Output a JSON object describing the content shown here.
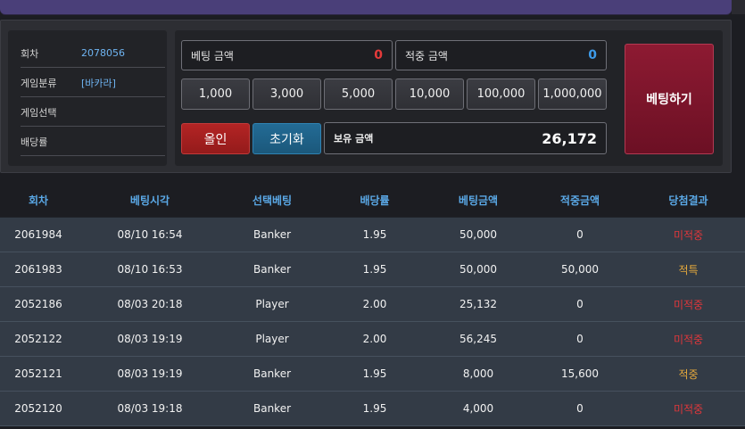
{
  "info": {
    "round_label": "회차",
    "round_value": "2078056",
    "category_label": "게임분류",
    "category_value": "[바카라]",
    "selection_label": "게임선택",
    "selection_value": "",
    "odds_label": "배당률",
    "odds_value": ""
  },
  "bet": {
    "amount_label": "베팅 금액",
    "amount_value": "0",
    "amount_color": "#e53a3a",
    "win_label": "적중 금액",
    "win_value": "0",
    "win_color": "#3d9be9",
    "chips": [
      "1,000",
      "3,000",
      "5,000",
      "10,000",
      "100,000",
      "1,000,000"
    ],
    "allin_label": "올인",
    "reset_label": "초기화",
    "balance_label": "보유 금액",
    "balance_value": "26,172",
    "submit_label": "베팅하기"
  },
  "history": {
    "headers": [
      "회차",
      "베팅시각",
      "선택베팅",
      "배당률",
      "베팅금액",
      "적중금액",
      "당첨결과"
    ],
    "rows": [
      {
        "round": "2061984",
        "time": "08/10 16:54",
        "pick": "Banker",
        "odds": "1.95",
        "bet": "50,000",
        "win": "0",
        "result": "미적중",
        "status": "lose"
      },
      {
        "round": "2061983",
        "time": "08/10 16:53",
        "pick": "Banker",
        "odds": "1.95",
        "bet": "50,000",
        "win": "50,000",
        "result": "적특",
        "status": "win"
      },
      {
        "round": "2052186",
        "time": "08/03 20:18",
        "pick": "Player",
        "odds": "2.00",
        "bet": "25,132",
        "win": "0",
        "result": "미적중",
        "status": "lose"
      },
      {
        "round": "2052122",
        "time": "08/03 19:19",
        "pick": "Player",
        "odds": "2.00",
        "bet": "56,245",
        "win": "0",
        "result": "미적중",
        "status": "lose"
      },
      {
        "round": "2052121",
        "time": "08/03 19:19",
        "pick": "Banker",
        "odds": "1.95",
        "bet": "8,000",
        "win": "15,600",
        "result": "적중",
        "status": "win"
      },
      {
        "round": "2052120",
        "time": "08/03 19:18",
        "pick": "Banker",
        "odds": "1.95",
        "bet": "4,000",
        "win": "0",
        "result": "미적중",
        "status": "lose"
      }
    ]
  },
  "colors": {
    "header_text": "#5aa8e6",
    "lose": "#e0373b",
    "win": "#e5a93c",
    "submit_bg": "#7d1530"
  }
}
